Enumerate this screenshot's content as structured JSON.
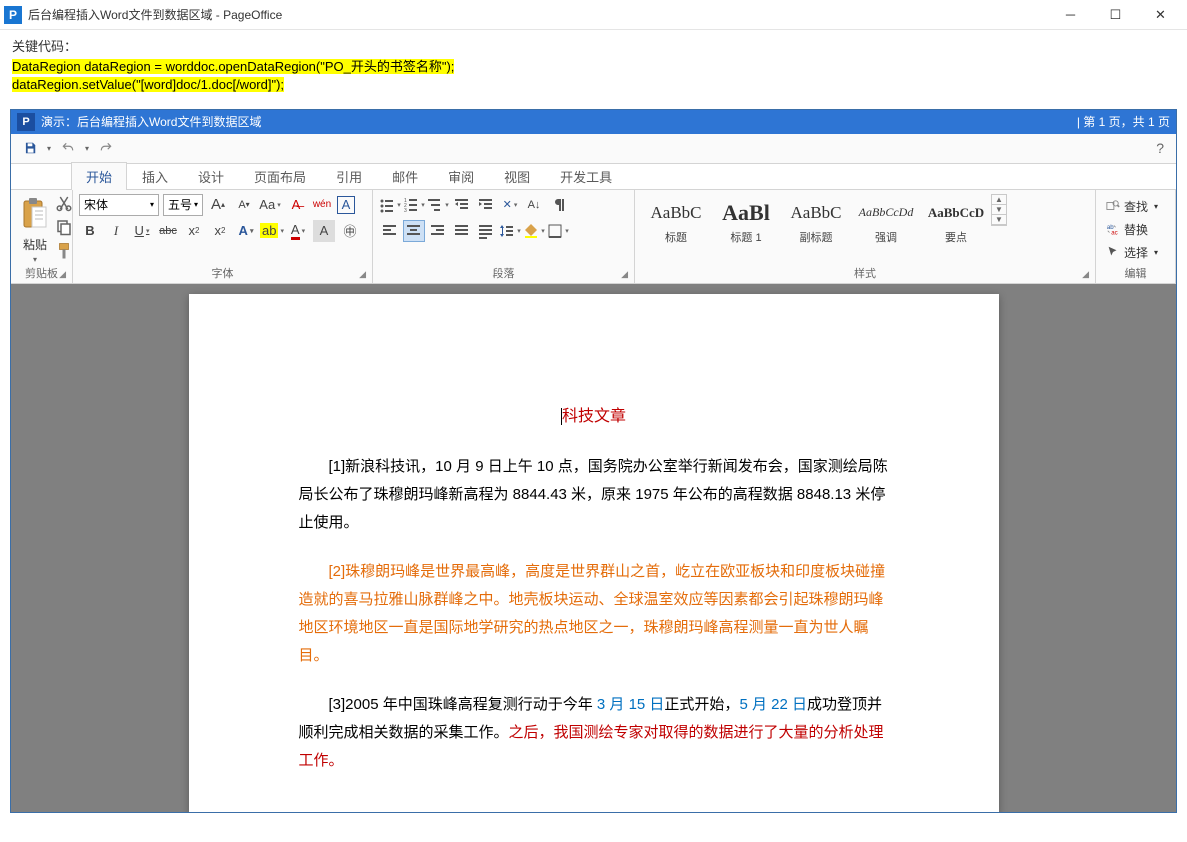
{
  "window": {
    "title": "后台编程插入Word文件到数据区域 - PageOffice",
    "icon_letter": "P"
  },
  "code": {
    "label": "关键代码：",
    "line1": "DataRegion dataRegion = worddoc.openDataRegion(\"PO_开头的书签名称\");",
    "line2": "dataRegion.setValue(\"[word]doc/1.doc[/word]\");"
  },
  "inner_header": {
    "icon_letter": "P",
    "title": "演示：后台编程插入Word文件到数据区域",
    "pager": "| 第 1 页，共 1 页"
  },
  "tabs": [
    "开始",
    "插入",
    "设计",
    "页面布局",
    "引用",
    "邮件",
    "审阅",
    "视图",
    "开发工具"
  ],
  "active_tab": 0,
  "groups": {
    "clipboard": {
      "label": "剪贴板",
      "paste": "粘贴"
    },
    "font": {
      "label": "字体",
      "fontname": "宋体",
      "fontsize": "五号",
      "bold": "B",
      "italic": "I",
      "underline": "U",
      "strike": "abc",
      "sub": "x₂",
      "sup": "x²",
      "grow": "A",
      "shrink": "A",
      "case": "Aa",
      "clear": "A",
      "phonetic": "wén",
      "border": "A",
      "hilite": "aᵇ",
      "color": "A",
      "fontcolor": "A"
    },
    "paragraph": {
      "label": "段落"
    },
    "styles": {
      "label": "样式",
      "items": [
        {
          "preview": "AaBbC",
          "name": "标题",
          "size": "17px",
          "weight": "normal",
          "family": "SimSun"
        },
        {
          "preview": "AaBl",
          "name": "标题 1",
          "size": "22px",
          "weight": "bold",
          "family": "SimHei"
        },
        {
          "preview": "AaBbC",
          "name": "副标题",
          "size": "17px",
          "weight": "normal",
          "family": "SimSun"
        },
        {
          "preview": "AaBbCcDd",
          "name": "强调",
          "size": "12px",
          "weight": "normal",
          "style": "italic",
          "family": "SimSun"
        },
        {
          "preview": "AaBbCcD",
          "name": "要点",
          "size": "13px",
          "weight": "bold",
          "family": "SimSun"
        }
      ]
    },
    "editing": {
      "label": "编辑",
      "find": "查找",
      "replace": "替换",
      "select": "选择"
    }
  },
  "document": {
    "title": "科技文章",
    "p1": "[1]新浪科技讯，10 月 9 日上午 10 点，国务院办公室举行新闻发布会，国家测绘局陈局长公布了珠穆朗玛峰新高程为 8844.43 米，原来 1975 年公布的高程数据 8848.13 米停止使用。",
    "p2": "[2]珠穆朗玛峰是世界最高峰，高度是世界群山之首，屹立在欧亚板块和印度板块碰撞造就的喜马拉雅山脉群峰之中。地壳板块运动、全球温室效应等因素都会引起珠穆朗玛峰地区环境地区一直是国际地学研究的热点地区之一，珠穆朗玛峰高程测量一直为世人瞩目。",
    "p3_a": "[3]2005 年中国珠峰高程复测行动于今年 ",
    "p3_b": "3 月 15 日",
    "p3_c": "正式开始，",
    "p3_d": "5 月 22 日",
    "p3_e": "成功登顶并顺利完成相关数据的采集工作。",
    "p3_f": "之后，我国测绘专家对取得的数据进行了大量的分析处理工作。"
  }
}
